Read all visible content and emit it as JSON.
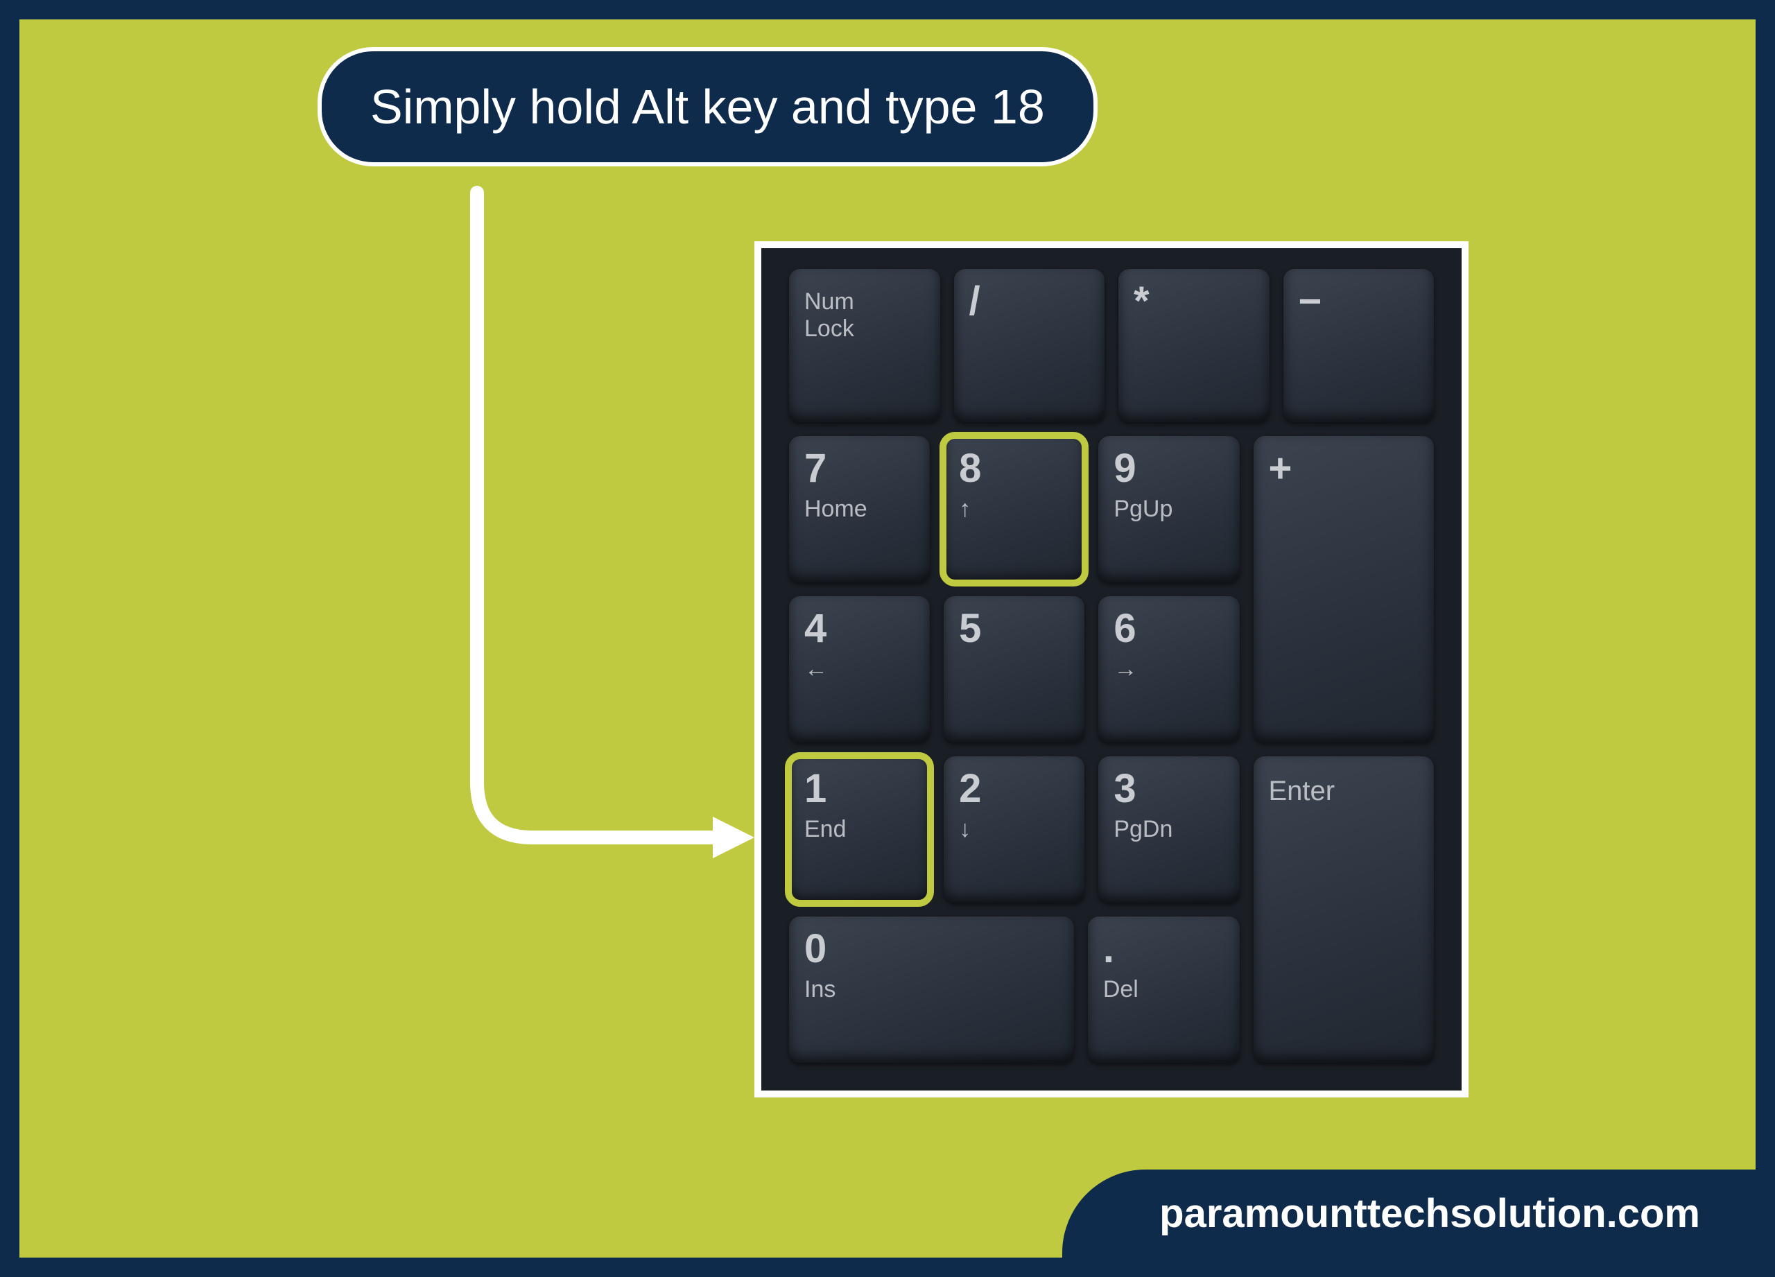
{
  "instruction": "Simply hold Alt key and type 18",
  "footer": "paramounttechsolution.com",
  "keypad": {
    "numlock": "Num\nLock",
    "slash": "/",
    "star": "*",
    "minus": "−",
    "plus": "+",
    "enter": "Enter",
    "row2": {
      "k7": {
        "main": "7",
        "sub": "Home"
      },
      "k8": {
        "main": "8",
        "sub": "↑"
      },
      "k9": {
        "main": "9",
        "sub": "PgUp"
      }
    },
    "row3": {
      "k4": {
        "main": "4",
        "sub": "←"
      },
      "k5": {
        "main": "5",
        "sub": ""
      },
      "k6": {
        "main": "6",
        "sub": "→"
      }
    },
    "row4": {
      "k1": {
        "main": "1",
        "sub": "End"
      },
      "k2": {
        "main": "2",
        "sub": "↓"
      },
      "k3": {
        "main": "3",
        "sub": "PgDn"
      }
    },
    "row5": {
      "k0": {
        "main": "0",
        "sub": "Ins"
      },
      "kdot": {
        "main": ".",
        "sub": "Del"
      }
    }
  }
}
